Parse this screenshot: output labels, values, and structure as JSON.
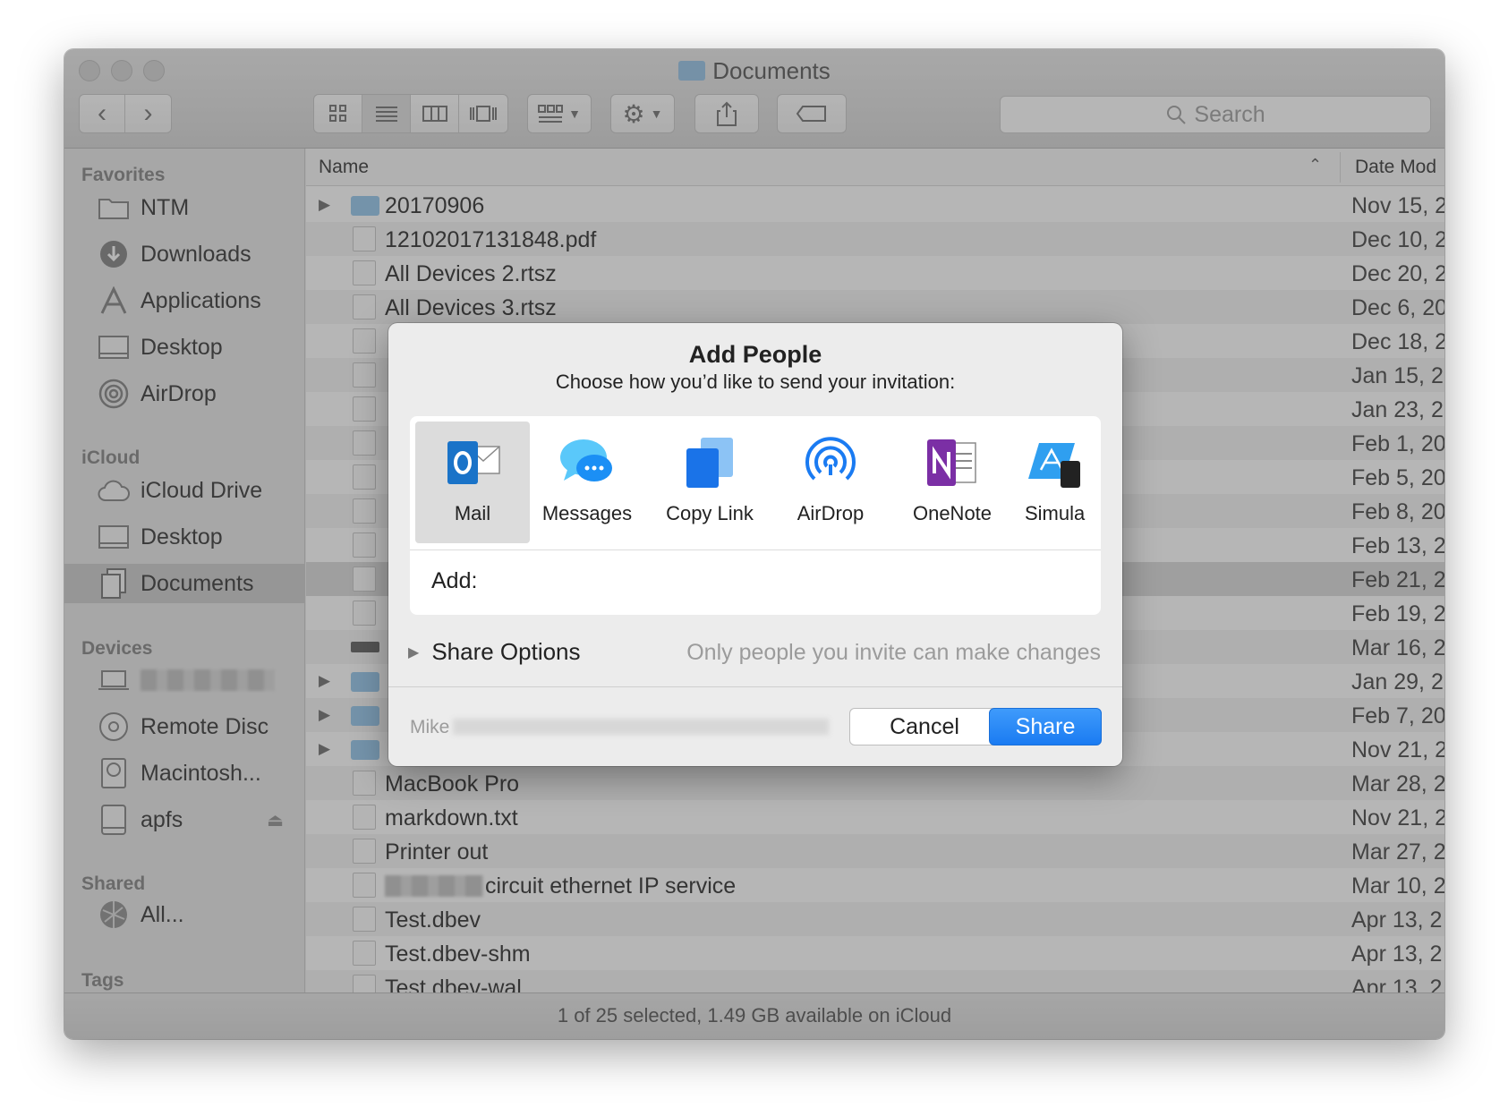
{
  "window": {
    "title": "Documents",
    "toolbar": {
      "back": "‹",
      "forward": "›",
      "search_placeholder": "Search"
    }
  },
  "sidebar": {
    "favorites_header": "Favorites",
    "favorites": [
      {
        "label": "NTM",
        "icon": "folder-icon"
      },
      {
        "label": "Downloads",
        "icon": "download-icon"
      },
      {
        "label": "Applications",
        "icon": "applications-icon"
      },
      {
        "label": "Desktop",
        "icon": "desktop-icon"
      },
      {
        "label": "AirDrop",
        "icon": "airdrop-icon"
      }
    ],
    "icloud_header": "iCloud",
    "icloud": [
      {
        "label": "iCloud Drive",
        "icon": "cloud-icon"
      },
      {
        "label": "Desktop",
        "icon": "desktop-icon"
      },
      {
        "label": "Documents",
        "icon": "documents-icon"
      }
    ],
    "devices_header": "Devices",
    "devices": [
      {
        "label": "",
        "icon": "laptop-icon"
      },
      {
        "label": "Remote Disc",
        "icon": "disc-icon"
      },
      {
        "label": "Macintosh...",
        "icon": "hard-drive-icon"
      },
      {
        "label": "apfs",
        "icon": "external-drive-icon"
      }
    ],
    "shared_header": "Shared",
    "shared": [
      {
        "label": "All...",
        "icon": "network-icon"
      }
    ],
    "tags_header": "Tags"
  },
  "filelist": {
    "name_header": "Name",
    "date_header": "Date Mod",
    "rows": [
      {
        "name": "20170906",
        "date": "Nov 15, 2",
        "type": "folder"
      },
      {
        "name": "12102017131848.pdf",
        "date": "Dec 10, 2",
        "type": "doc"
      },
      {
        "name": "All Devices 2.rtsz",
        "date": "Dec 20, 2",
        "type": "doc"
      },
      {
        "name": "All Devices 3.rtsz",
        "date": "Dec 6, 20",
        "type": "doc"
      },
      {
        "name": "",
        "date": "Dec 18, 2",
        "type": "doc"
      },
      {
        "name": "",
        "date": "Jan 15, 2",
        "type": "doc"
      },
      {
        "name": "",
        "date": "Jan 23, 2",
        "type": "doc"
      },
      {
        "name": "",
        "date": "Feb 1, 20",
        "type": "doc"
      },
      {
        "name": "",
        "date": "Feb 5, 20",
        "type": "doc"
      },
      {
        "name": "",
        "date": "Feb 8, 20",
        "type": "doc"
      },
      {
        "name": "",
        "date": "Feb 13, 2",
        "type": "doc"
      },
      {
        "name": "",
        "date": "Feb 21, 2",
        "type": "doc"
      },
      {
        "name": "",
        "date": "Feb 19, 2",
        "type": "doc"
      },
      {
        "name": "",
        "date": "Mar 16, 2",
        "type": "drive"
      },
      {
        "name": "",
        "date": "Jan 29, 2",
        "type": "folder"
      },
      {
        "name": "",
        "date": "Feb 7, 20",
        "type": "folder"
      },
      {
        "name": "",
        "date": "Nov 21, 2",
        "type": "folder"
      },
      {
        "name": "MacBook Pro",
        "date": "Mar 28, 2",
        "type": "doc"
      },
      {
        "name": "markdown.txt",
        "date": "Nov 21, 2",
        "type": "doc"
      },
      {
        "name": "Printer out",
        "date": "Mar 27, 2",
        "type": "doc"
      },
      {
        "name": "circuit ethernet IP service",
        "date": "Mar 10, 2",
        "type": "doc"
      },
      {
        "name": "Test.dbev",
        "date": "Apr 13, 2",
        "type": "doc"
      },
      {
        "name": "Test.dbev-shm",
        "date": "Apr 13, 2",
        "type": "doc"
      },
      {
        "name": "Test.dbev-wal",
        "date": "Apr 13, 2",
        "type": "doc"
      }
    ]
  },
  "status": "1 of 25 selected, 1.49 GB available on iCloud",
  "dialog": {
    "title": "Add People",
    "subtitle": "Choose how you’d like to send your invitation:",
    "services": [
      {
        "label": "Mail",
        "icon": "outlook-mail-icon"
      },
      {
        "label": "Messages",
        "icon": "messages-icon"
      },
      {
        "label": "Copy Link",
        "icon": "copy-link-icon"
      },
      {
        "label": "AirDrop",
        "icon": "airdrop-icon"
      },
      {
        "label": "OneNote",
        "icon": "onenote-icon"
      },
      {
        "label": "Simula",
        "icon": "simulator-icon"
      }
    ],
    "add_label": "Add:",
    "share_options": "Share Options",
    "share_hint": "Only people you invite can make changes",
    "owner_prefix": "Mike",
    "cancel": "Cancel",
    "share": "Share"
  },
  "colors": {
    "accent": "#1a7bf2",
    "folder": "#8ec3ea"
  }
}
